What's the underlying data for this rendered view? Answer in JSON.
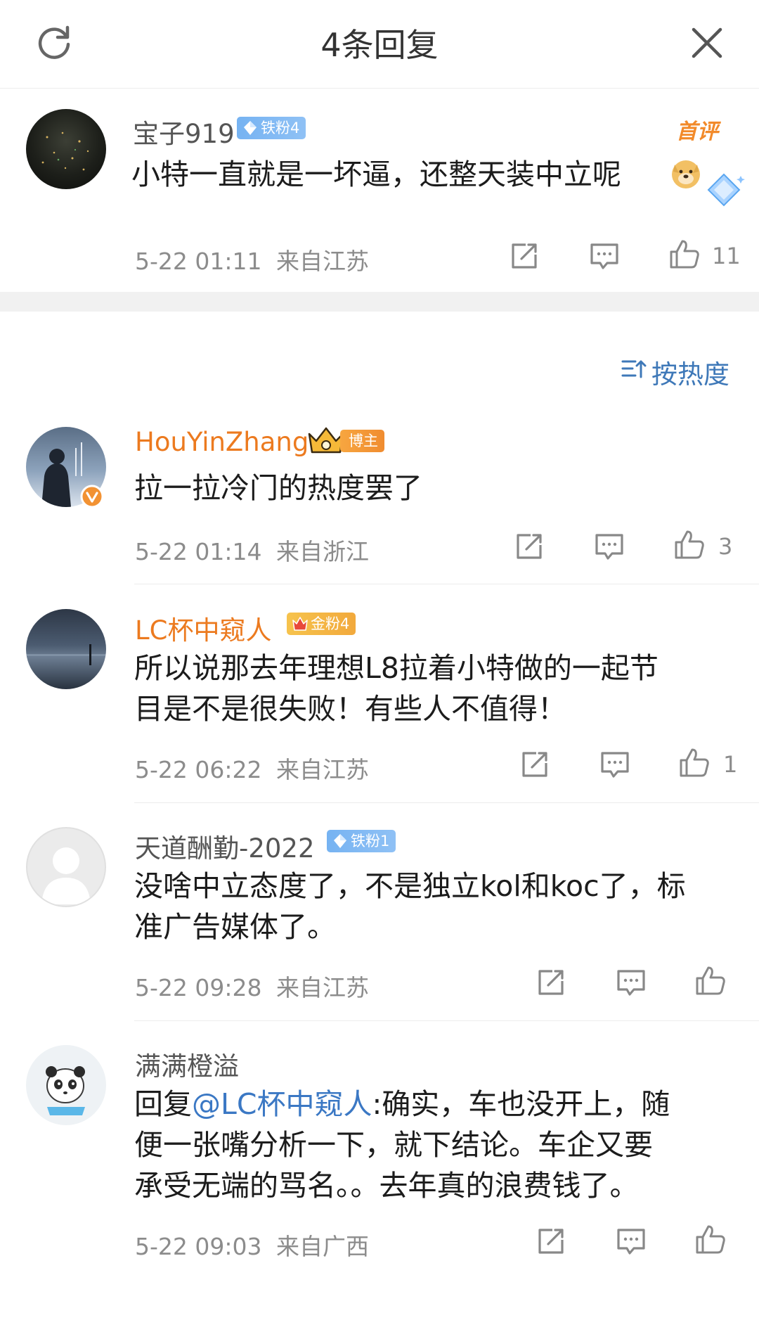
{
  "header": {
    "title": "4条回复",
    "refresh_icon": "refresh-icon",
    "close_icon": "close-icon"
  },
  "root_comment": {
    "author": "宝子919",
    "badge": "铁粉4",
    "tag": "首评",
    "text": "小特一直就是一坏逼，还整天装中立呢",
    "time": "5-22 01:11",
    "location": "来自江苏",
    "likes": "11"
  },
  "sort": {
    "label": "按热度",
    "icon": "sort-icon"
  },
  "replies": [
    {
      "author": "HouYinZhang",
      "badge": "博主",
      "lines": [
        "拉一拉冷门的热度罢了"
      ],
      "time": "5-22 01:14",
      "location": "来自浙江",
      "likes": "3"
    },
    {
      "author": "LC杯中窥人",
      "badge": "金粉4",
      "lines": [
        "所以说那去年理想L8拉着小特做的一起节",
        "目是不是很失败！有些人不值得！"
      ],
      "time": "5-22 06:22",
      "location": "来自江苏",
      "likes": "1"
    },
    {
      "author": "天道酬勤-2022",
      "badge": "铁粉1",
      "lines": [
        "没啥中立态度了，不是独立kol和koc了，标",
        "准广告媒体了。"
      ],
      "time": "5-22 09:28",
      "location": "来自江苏",
      "likes": ""
    },
    {
      "author": "满满橙溢",
      "badge": "",
      "reply_prefix": "回复",
      "mention": "@LC杯中窥人",
      "first_line_rest": ":确实，车也没开上，随",
      "lines": [
        "便一张嘴分析一下，就下结论。车企又要",
        "承受无端的骂名。。去年真的浪费钱了。"
      ],
      "time": "5-22 09:03",
      "location": "来自广西",
      "likes": ""
    }
  ],
  "colors": {
    "accent_orange": "#ec7a1f",
    "link_blue": "#3b78c4",
    "meta_gray": "#8c8c8c"
  }
}
